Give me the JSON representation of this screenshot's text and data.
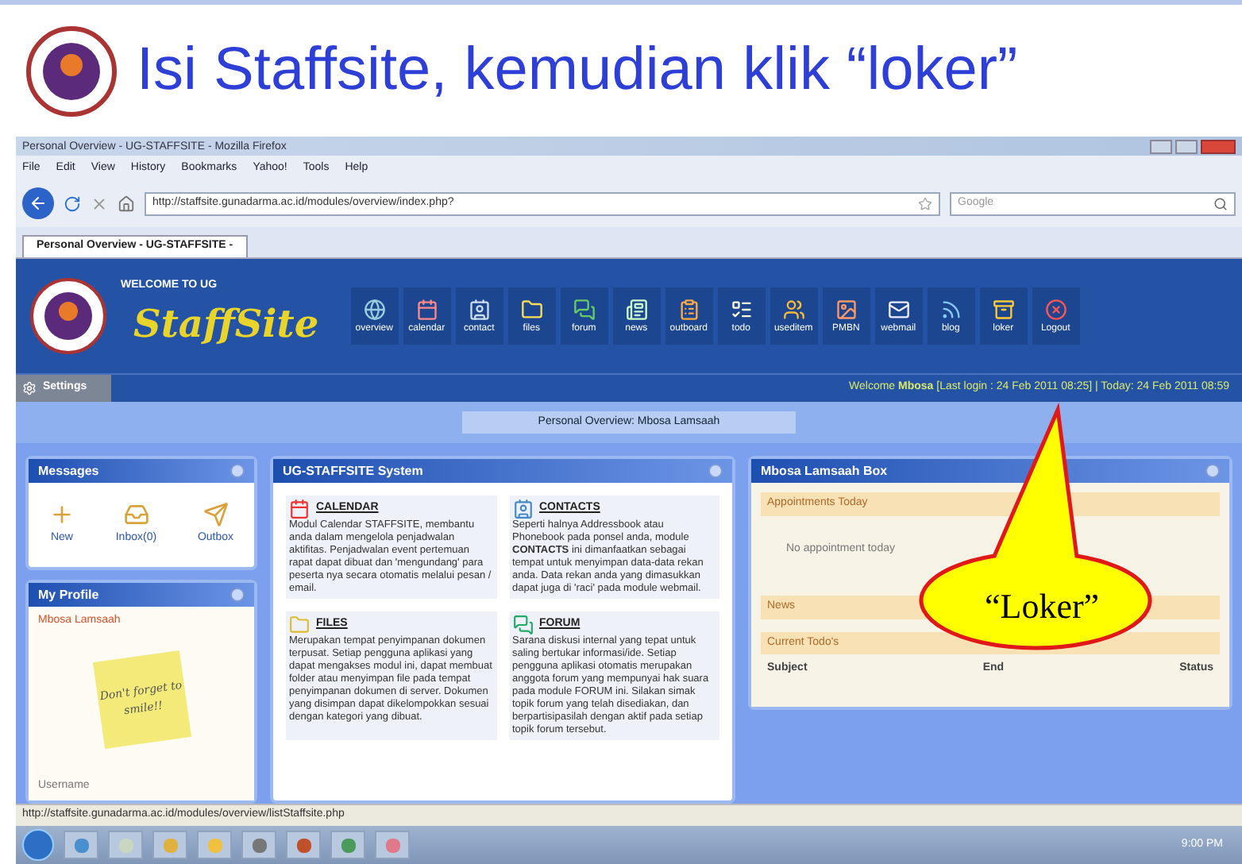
{
  "slide": {
    "title": "Isi Staffsite, kemudian klik “loker”",
    "callout": "“Loker”"
  },
  "browser": {
    "title": "Personal Overview - UG-STAFFSITE - Mozilla Firefox",
    "menu": [
      "File",
      "Edit",
      "View",
      "History",
      "Bookmarks",
      "Yahoo!",
      "Tools",
      "Help"
    ],
    "url": "http://staffsite.gunadarma.ac.id/modules/overview/index.php?",
    "search_placeholder": "Google",
    "tabs": [
      {
        "label": "Personal Overview - UG-STAFFSITE -",
        "selected": true
      }
    ],
    "status": "http://staffsite.gunadarma.ac.id/modules/overview/listStaffsite.php"
  },
  "site": {
    "welcome": "WELCOME TO UG",
    "logo_text": "StaffSite",
    "nav": [
      "overview",
      "calendar",
      "contact",
      "files",
      "forum",
      "news",
      "outboard",
      "todo",
      "useditem",
      "PMBN",
      "webmail",
      "blog",
      "loker",
      "Logout"
    ],
    "settings": "Settings",
    "greeting": "Welcome **Mbosa** [Last login : 24 Feb 2011 08:25] | Today: 24 Feb 2011 08:59",
    "page_title": "Personal Overview: Mbosa Lamsaah"
  },
  "messages": {
    "title": "Messages",
    "items": [
      "New",
      "Inbox(0)",
      "Outbox"
    ]
  },
  "profile": {
    "title": "My Profile",
    "name": "Mbosa Lamsaah",
    "note": "Don't forget to smile!!",
    "username_label": "Username"
  },
  "system": {
    "title": "UG-STAFFSITE System",
    "modules": [
      {
        "title": "CALENDAR",
        "text": "Modul Calendar STAFFSITE, membantu anda dalam mengelola penjadwalan aktifitas. Penjadwalan event pertemuan rapat dapat dibuat dan 'mengundang' para peserta nya secara otomatis melalui pesan / email."
      },
      {
        "title": "CONTACTS",
        "text": "Seperti halnya Addressbook atau Phonebook pada ponsel anda, module **CONTACTS** ini dimanfaatkan sebagai tempat untuk menyimpan data-data rekan anda. Data rekan anda yang dimasukkan dapat juga di 'raci' pada module webmail."
      },
      {
        "title": "FILES",
        "text": "Merupakan tempat penyimpanan dokumen terpusat. Setiap pengguna aplikasi yang dapat mengakses modul ini, dapat membuat folder atau menyimpan file pada tempat penyimpanan dokumen di server. Dokumen yang disimpan dapat dikelompokkan sesuai dengan kategori yang dibuat."
      },
      {
        "title": "FORUM",
        "text": "Sarana diskusi internal yang tepat untuk saling bertukar informasi/ide. Setiap pengguna aplikasi otomatis merupakan anggota forum yang mempunyai hak suara pada module FORUM ini. Silakan simak topik forum yang telah disediakan, dan berpartisipasilah dengan aktif pada setiap topik forum tersebut."
      }
    ]
  },
  "box": {
    "title": "Mbosa Lamsaah Box",
    "sections": [
      {
        "title": "Appointments Today",
        "empty": "No appointment today"
      },
      {
        "title": "News"
      },
      {
        "title": "Current Todo's",
        "columns": [
          "Subject",
          "End",
          "Status"
        ]
      }
    ]
  },
  "taskbar": {
    "clock": "9:00 PM"
  }
}
